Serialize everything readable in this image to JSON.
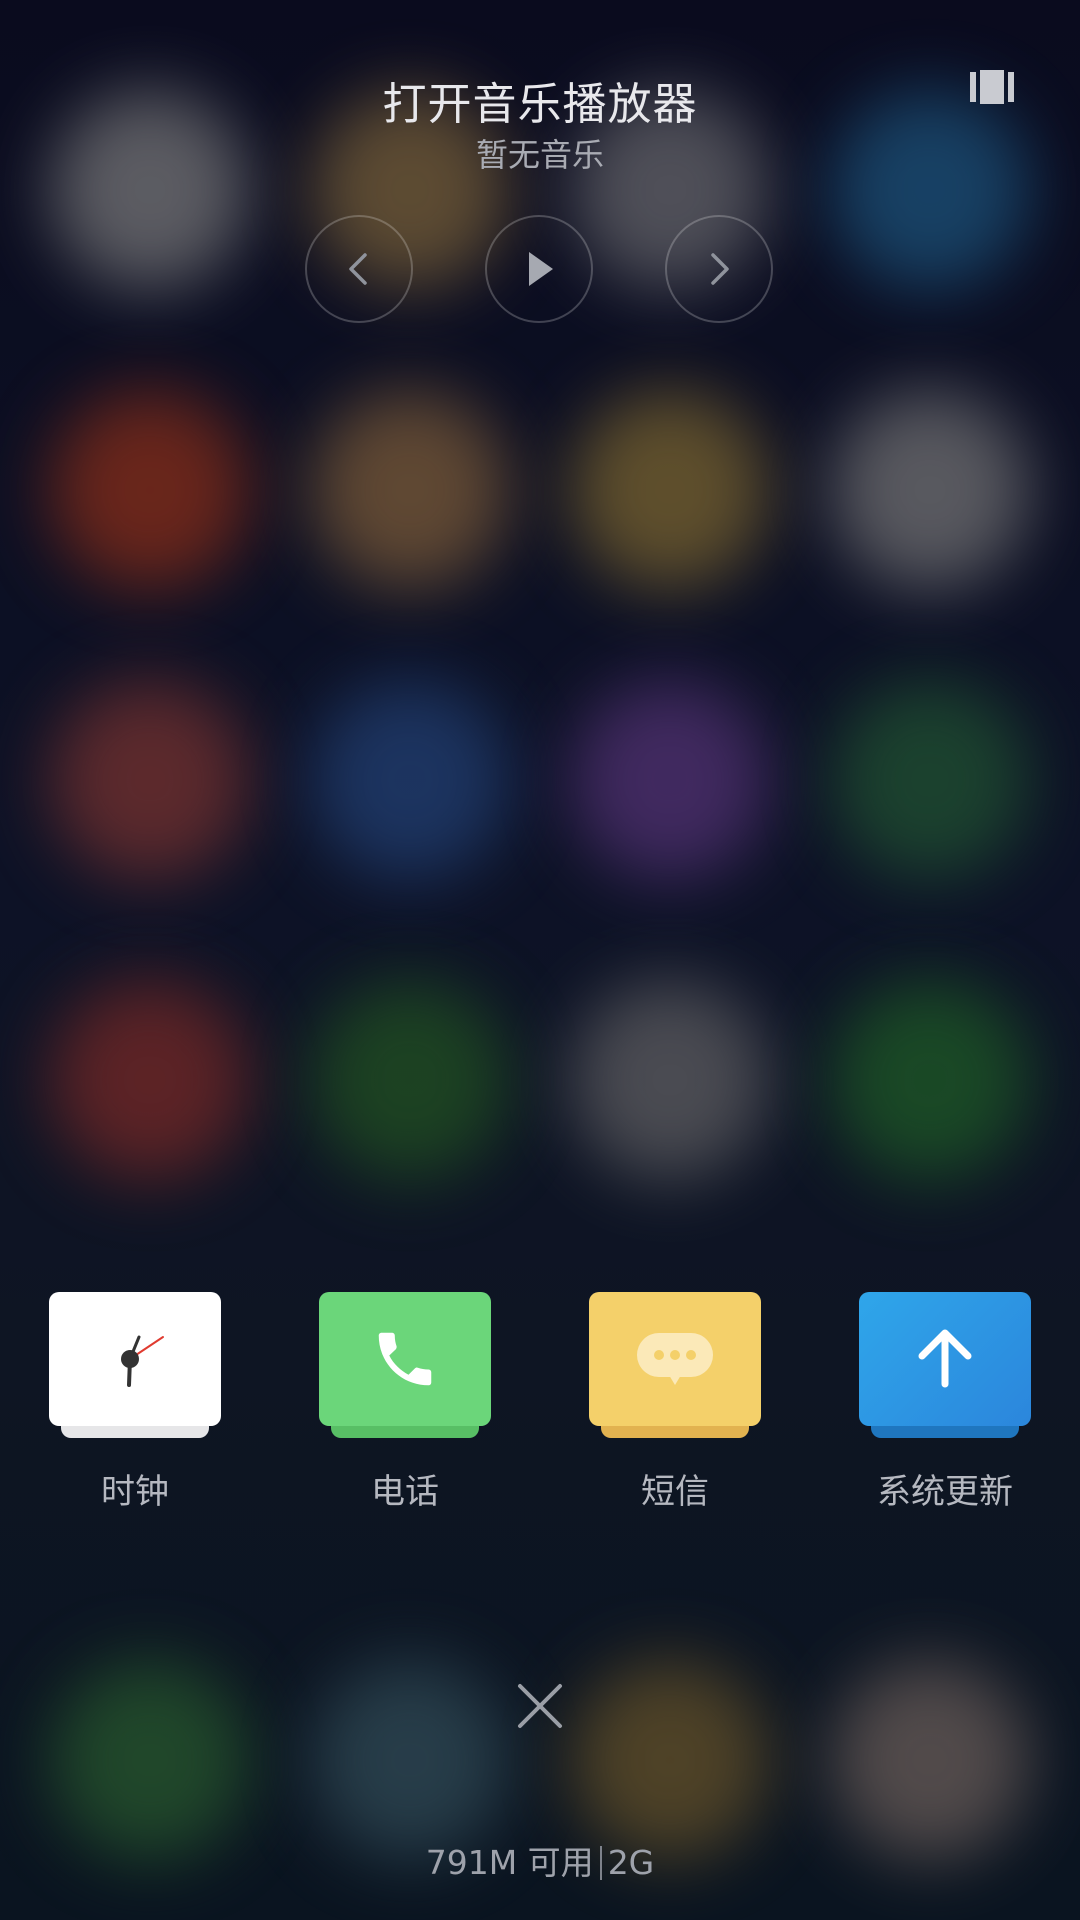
{
  "music_player": {
    "title": "打开音乐播放器",
    "subtitle": "暂无音乐",
    "prev_icon": "chevron-left-icon",
    "play_icon": "play-icon",
    "next_icon": "chevron-right-icon",
    "mode_icon": "card-switch-icon"
  },
  "shortcuts": [
    {
      "label": "时钟",
      "icon": "clock-icon",
      "color": "#ffffff"
    },
    {
      "label": "电话",
      "icon": "phone-icon",
      "color": "#6bd67a"
    },
    {
      "label": "短信",
      "icon": "message-icon",
      "color": "#f4d06a"
    },
    {
      "label": "系统更新",
      "icon": "arrow-up-icon",
      "color": "#2b8fe0"
    }
  ],
  "memory": {
    "available": "791M 可用",
    "total": "2G"
  },
  "close_icon": "close-icon"
}
